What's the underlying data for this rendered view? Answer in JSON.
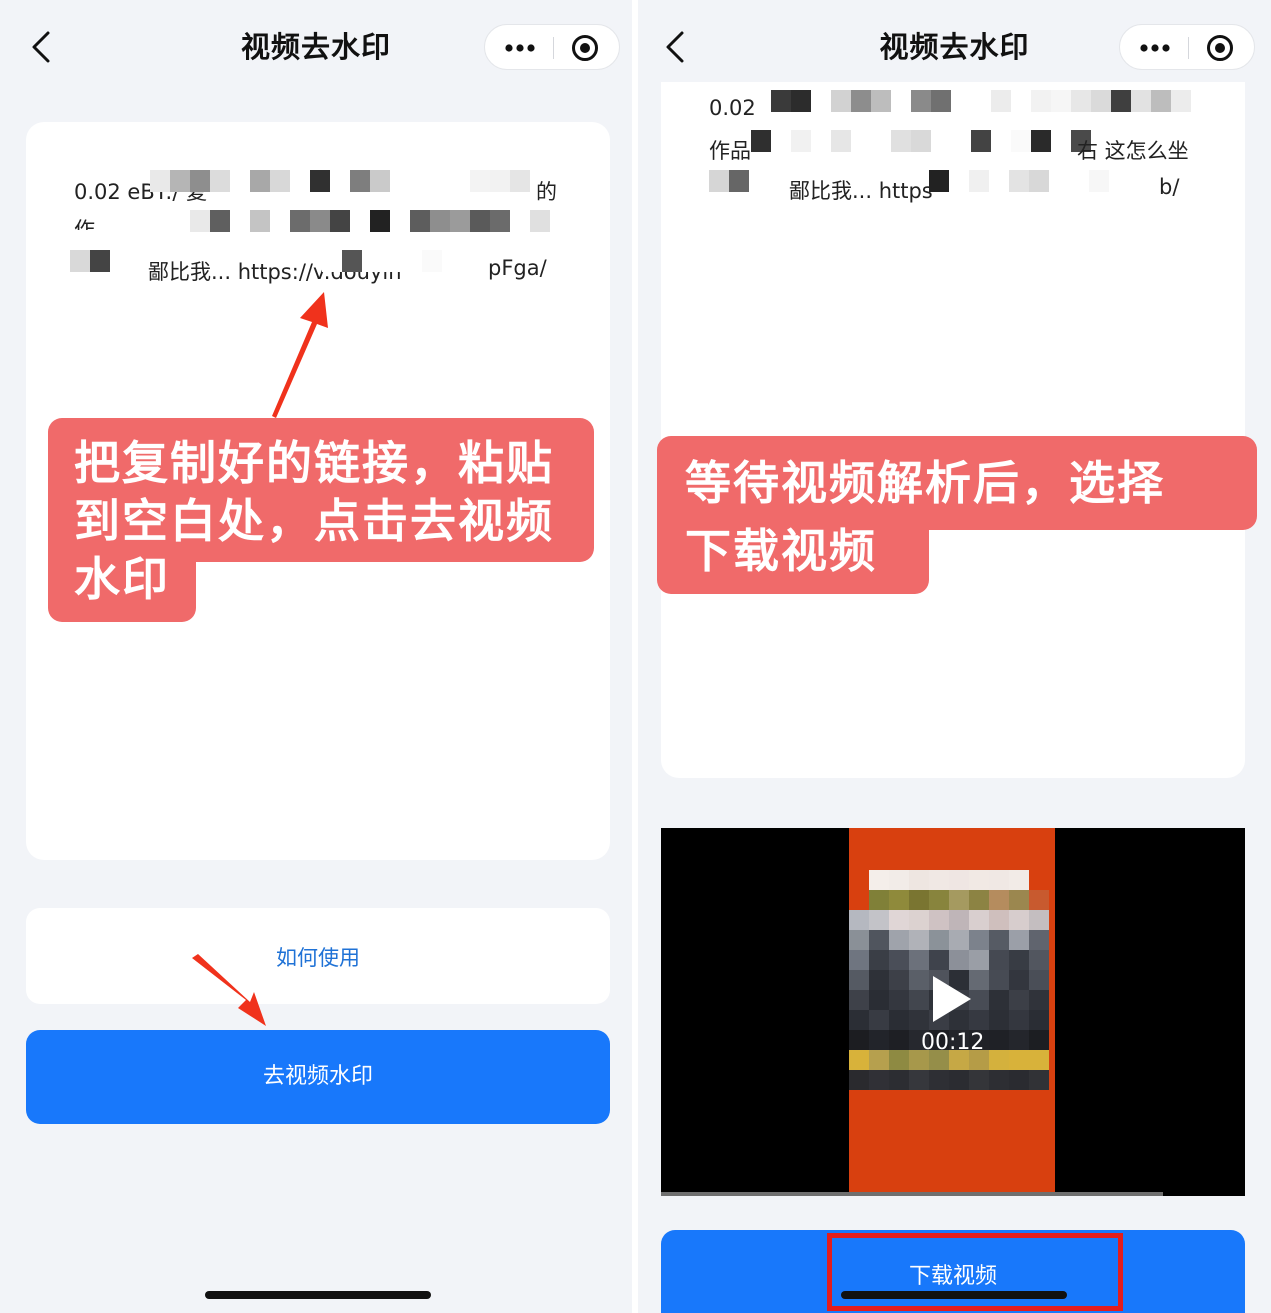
{
  "left": {
    "nav_title": "视频去水印",
    "text_lines": [
      "0.02 eBT:/ 复",
      "作",
      "鄙比我... https://v.douyin",
      "的",
      "pFga/"
    ],
    "callout_lines": [
      "把复制好的链接，粘贴",
      "到空白处，点击去视频",
      "水印"
    ],
    "how_to_use": "如何使用",
    "primary_button": "去视频水印"
  },
  "right": {
    "nav_title": "视频去水印",
    "text_lines": [
      "0.02",
      "作品",
      "右 这怎么坐",
      "鄙比我... https",
      "b/"
    ],
    "callout_lines": [
      "等待视频解析后，选择",
      "下载视频"
    ],
    "video_duration": "00:12",
    "download_button": "下载视频"
  },
  "icons": {
    "back": "chevron-left-icon",
    "more": "more-dots-icon",
    "close": "close-circle-icon",
    "play": "play-icon"
  },
  "colors": {
    "accent": "#1878fb",
    "callout": "#f06a6a",
    "highlight": "#e41d1d",
    "link": "#1f72d6"
  }
}
